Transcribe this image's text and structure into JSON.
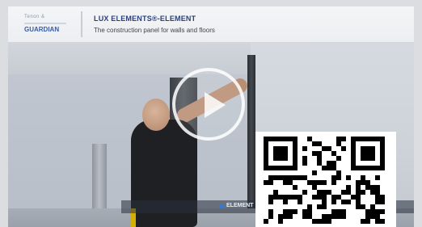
{
  "video": {
    "banner": {
      "brand_top": "Tenon &",
      "brand_name": "GUARDIAN",
      "title": "LUX ELEMENTS®-ELEMENT",
      "subtitle": "The construction panel for walls and floors"
    },
    "ribbon_text": "ELEMENT",
    "play_label": "Play video"
  },
  "colors": {
    "title": "#2b3e7a",
    "accent": "#2f7bd6",
    "qr_dark": "#000000",
    "qr_light": "#ffffff"
  },
  "icons": {
    "play": "play-icon",
    "qr": "qr-code"
  }
}
